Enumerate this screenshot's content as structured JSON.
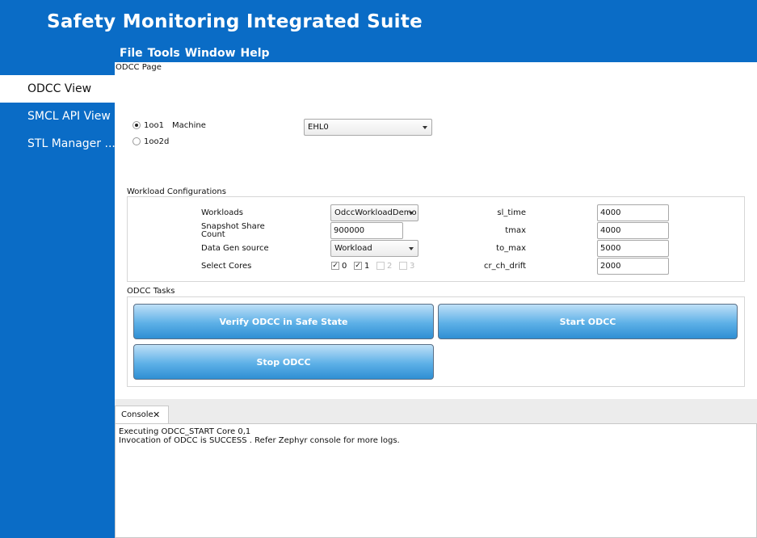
{
  "app": {
    "title": "Safety Monitoring Integrated Suite"
  },
  "menu": [
    "File",
    "Tools",
    "Window",
    "Help"
  ],
  "sidebar": {
    "items": [
      {
        "label": "ODCC View",
        "active": true
      },
      {
        "label": "SMCL API View",
        "active": false
      },
      {
        "label": "STL Manager ...",
        "active": false
      }
    ]
  },
  "page": {
    "title": "ODCC Page",
    "mode": {
      "options": [
        {
          "label": "1oo1",
          "selected": true
        },
        {
          "label": "1oo2d",
          "selected": false
        }
      ],
      "machine_label": "Machine",
      "machine_value": "EHL0"
    },
    "workload": {
      "section_title": "Workload Configurations",
      "workloads_label": "Workloads",
      "workloads_value": "OdccWorkloadDemo",
      "snapshot_label": "Snapshot Share Count",
      "snapshot_value": "900000",
      "datagen_label": "Data Gen source",
      "datagen_value": "Workload",
      "cores_label": "Select Cores",
      "cores": [
        {
          "label": "0",
          "checked": true,
          "enabled": true
        },
        {
          "label": "1",
          "checked": true,
          "enabled": true
        },
        {
          "label": "2",
          "checked": false,
          "enabled": false
        },
        {
          "label": "3",
          "checked": false,
          "enabled": false
        }
      ],
      "params": [
        {
          "label": "sl_time",
          "value": "4000"
        },
        {
          "label": "tmax",
          "value": "4000"
        },
        {
          "label": "to_max",
          "value": "5000"
        },
        {
          "label": "cr_ch_drift",
          "value": "2000"
        }
      ]
    },
    "tasks": {
      "section_title": "ODCC Tasks",
      "verify_label": "Verify ODCC in Safe State",
      "start_label": "Start ODCC",
      "stop_label": "Stop ODCC"
    }
  },
  "console": {
    "tab_label": "Console",
    "lines": [
      "Executing ODCC_START Core 0,1",
      "Invocation of ODCC is SUCCESS . Refer Zephyr console for more logs."
    ]
  },
  "colors": {
    "brand_blue": "#0a6cc6",
    "button_blue": "#5db0e7"
  }
}
